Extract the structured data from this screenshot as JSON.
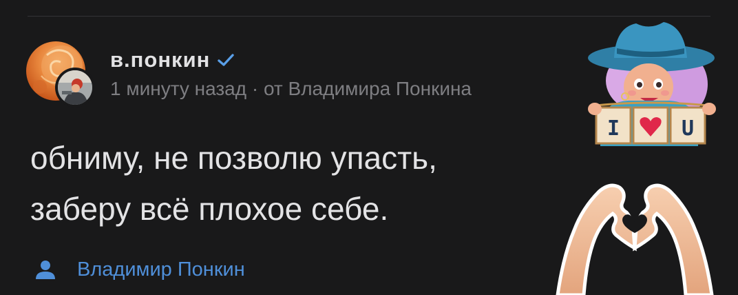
{
  "post": {
    "author_name": "в.понкин",
    "meta": "1 минуту назад · от Владимира Понкина",
    "text_line_1": "обниму, не позволю упасть,",
    "text_line_2": "заберу всё плохое себе.",
    "signature": "Владимир Понкин"
  },
  "sticker_girl": {
    "sign_text_1": "I",
    "sign_text_2": "U"
  },
  "icons": {
    "verified": "verified-check-icon",
    "user": "user-icon"
  },
  "colors": {
    "background": "#19191a",
    "text_primary": "#e3e3e5",
    "text_secondary": "#7e7e82",
    "link_blue": "#4f8fd9",
    "verified_blue": "#5a9fe8"
  }
}
